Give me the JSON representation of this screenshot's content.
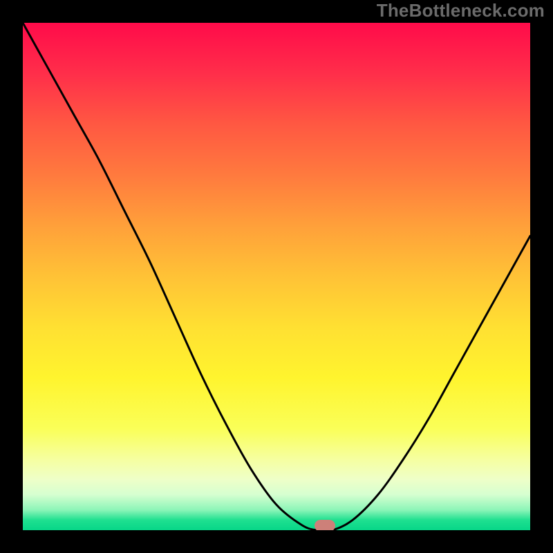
{
  "watermark": "TheBottleneck.com",
  "chart_data": {
    "type": "line",
    "title": "",
    "xlabel": "",
    "ylabel": "",
    "x": [
      0.0,
      0.05,
      0.1,
      0.15,
      0.2,
      0.25,
      0.3,
      0.35,
      0.4,
      0.45,
      0.5,
      0.55,
      0.58,
      0.61,
      0.65,
      0.7,
      0.75,
      0.8,
      0.85,
      0.9,
      0.95,
      1.0
    ],
    "values": [
      1.0,
      0.91,
      0.82,
      0.73,
      0.63,
      0.53,
      0.42,
      0.31,
      0.21,
      0.12,
      0.05,
      0.01,
      0.0,
      0.0,
      0.02,
      0.07,
      0.14,
      0.22,
      0.31,
      0.4,
      0.49,
      0.58
    ],
    "xlim": [
      0,
      1
    ],
    "ylim": [
      0,
      1
    ],
    "baseline_marker": {
      "x": 0.595,
      "y": 0.0
    },
    "colors": {
      "top": "#ff0b4a",
      "mid": "#ffe032",
      "bottom": "#07d688",
      "curve": "#000000",
      "marker": "#cd8079",
      "watermark": "#6b6b6b"
    }
  }
}
